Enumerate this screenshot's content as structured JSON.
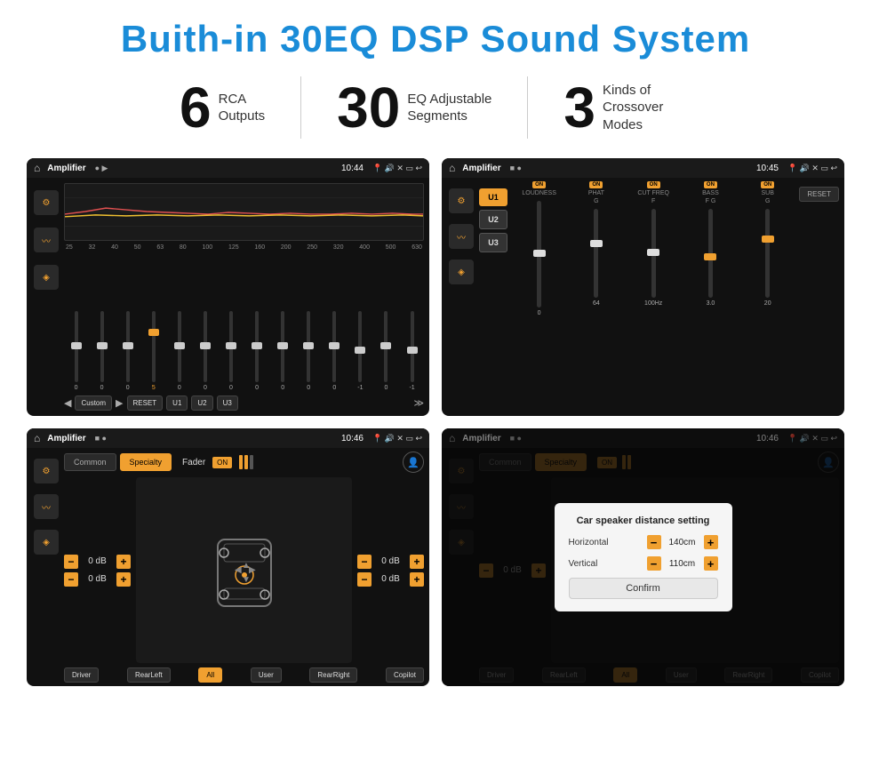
{
  "title": "Buith-in 30EQ DSP Sound System",
  "stats": [
    {
      "number": "6",
      "label_line1": "RCA",
      "label_line2": "Outputs"
    },
    {
      "number": "30",
      "label_line1": "EQ Adjustable",
      "label_line2": "Segments"
    },
    {
      "number": "3",
      "label_line1": "Kinds of",
      "label_line2": "Crossover Modes"
    }
  ],
  "screens": [
    {
      "id": "eq-screen",
      "title": "Amplifier",
      "time": "10:44",
      "type": "eq",
      "freqs": [
        "25",
        "32",
        "40",
        "50",
        "63",
        "80",
        "100",
        "125",
        "160",
        "200",
        "250",
        "320",
        "400",
        "500",
        "630"
      ],
      "values": [
        "0",
        "0",
        "0",
        "5",
        "0",
        "0",
        "0",
        "0",
        "0",
        "0",
        "0",
        "-1",
        "0",
        "-1"
      ],
      "presets": [
        "Custom",
        "RESET",
        "U1",
        "U2",
        "U3"
      ]
    },
    {
      "id": "amp-screen",
      "title": "Amplifier",
      "time": "10:45",
      "type": "amp",
      "presets": [
        "U1",
        "U2",
        "U3"
      ],
      "channels": [
        {
          "name": "LOUDNESS",
          "on": true
        },
        {
          "name": "PHAT",
          "on": true
        },
        {
          "name": "CUT FREQ",
          "on": true
        },
        {
          "name": "BASS",
          "on": true
        },
        {
          "name": "SUB",
          "on": true
        }
      ]
    },
    {
      "id": "fader-screen",
      "title": "Amplifier",
      "time": "10:46",
      "type": "fader",
      "tabs": [
        "Common",
        "Specialty"
      ],
      "fader_label": "Fader",
      "fader_on": "ON",
      "vol_labels": [
        "0 dB",
        "0 dB",
        "0 dB",
        "0 dB"
      ],
      "btns": [
        "Driver",
        "RearLeft",
        "All",
        "User",
        "RearRight",
        "Copilot"
      ]
    },
    {
      "id": "dialog-screen",
      "title": "Amplifier",
      "time": "10:46",
      "type": "dialog",
      "tabs": [
        "Common",
        "Specialty"
      ],
      "dialog": {
        "title": "Car speaker distance setting",
        "fields": [
          {
            "label": "Horizontal",
            "value": "140cm"
          },
          {
            "label": "Vertical",
            "value": "110cm"
          }
        ],
        "confirm": "Confirm"
      },
      "btns": [
        "Driver",
        "RearLeft",
        "All",
        "User",
        "RearRight",
        "Copilot"
      ]
    }
  ]
}
